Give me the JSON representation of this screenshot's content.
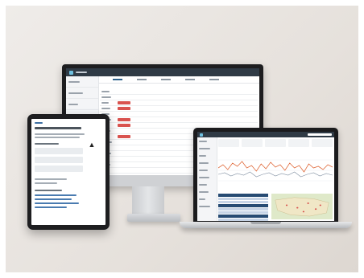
{
  "scene": {
    "devices": [
      "desktop-monitor",
      "tablet",
      "laptop"
    ],
    "background_color": "#e9e5e1"
  },
  "desktop_app": {
    "accent_color": "#2b5f8a",
    "alert_color": "#d9534f",
    "topbar_color": "#2f3a45"
  },
  "tablet_app": {
    "badge_icon": "upload-icon",
    "badge_glyph": "▲",
    "link_color": "#4a7bb0"
  },
  "laptop_app": {
    "chart_color": "#e06a3b",
    "table_header_color": "#274b73",
    "map_color": "#dfe9c9"
  }
}
